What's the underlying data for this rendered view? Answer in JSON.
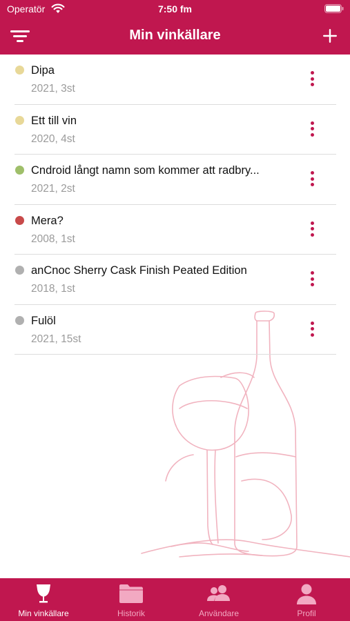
{
  "status_bar": {
    "carrier": "Operatör",
    "time": "7:50 fm"
  },
  "header": {
    "title": "Min vinkällare",
    "filter_icon": "filter-icon",
    "add_icon": "plus-icon"
  },
  "wines": [
    {
      "name": "Dipa",
      "detail": "2021, 3st",
      "color": "#e8d898"
    },
    {
      "name": "Ett till vin",
      "detail": "2020, 4st",
      "color": "#e8d898"
    },
    {
      "name": "Cndroid långt namn som kommer att radbry...",
      "detail": "2021, 2st",
      "color": "#9fbf6a"
    },
    {
      "name": "Mera?",
      "detail": "2008, 1st",
      "color": "#c84a4a"
    },
    {
      "name": "anCnoc Sherry Cask Finish Peated Edition",
      "detail": "2018, 1st",
      "color": "#b0b0b0"
    },
    {
      "name": "Fulöl",
      "detail": "2021, 15st",
      "color": "#b0b0b0"
    }
  ],
  "tabs": [
    {
      "label": "Min vinkällare",
      "icon": "wine-glass-icon",
      "active": true
    },
    {
      "label": "Historik",
      "icon": "folder-icon",
      "active": false
    },
    {
      "label": "Användare",
      "icon": "users-icon",
      "active": false
    },
    {
      "label": "Profil",
      "icon": "person-icon",
      "active": false
    }
  ],
  "colors": {
    "brand": "#c0174f",
    "tab_active": "#ffffff",
    "tab_inactive": "#f2a9c2",
    "more_dots": "#c0174f"
  }
}
